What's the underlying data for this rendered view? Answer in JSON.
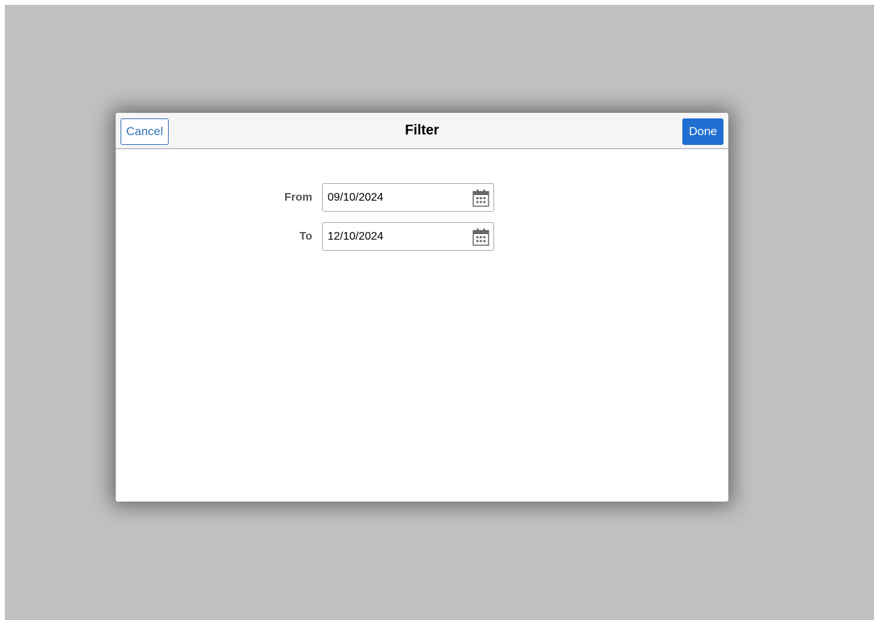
{
  "dialog": {
    "title": "Filter",
    "cancel_label": "Cancel",
    "done_label": "Done"
  },
  "form": {
    "from": {
      "label": "From",
      "value": "09/10/2024",
      "icon": "calendar-icon"
    },
    "to": {
      "label": "To",
      "value": "12/10/2024",
      "icon": "calendar-icon"
    }
  },
  "colors": {
    "backdrop": "#c0c0c0",
    "header_bg": "#f5f5f5",
    "accent": "#1f6ed0",
    "cancel_text": "#2e6fb5",
    "label_text": "#555555"
  }
}
